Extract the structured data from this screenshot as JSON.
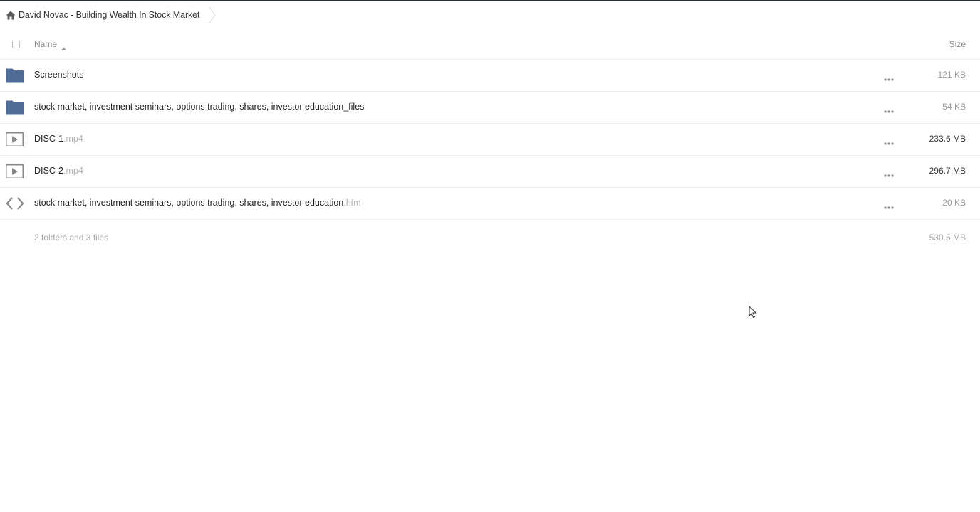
{
  "breadcrumb": {
    "home_icon": "home-icon",
    "label": "David Novac - Building Wealth In Stock Market"
  },
  "columns": {
    "name": "Name",
    "size": "Size",
    "sort": "ascending"
  },
  "rows": [
    {
      "icon": "folder-icon",
      "name": "Screenshots",
      "ext": "",
      "size": "121 KB",
      "size_emphasis": false
    },
    {
      "icon": "folder-icon",
      "name": "stock market, investment seminars, options trading, shares, investor education_files",
      "ext": "",
      "size": "54 KB",
      "size_emphasis": false
    },
    {
      "icon": "video-file-icon",
      "name": "DISC-1",
      "ext": ".mp4",
      "size": "233.6 MB",
      "size_emphasis": true
    },
    {
      "icon": "video-file-icon",
      "name": "DISC-2",
      "ext": ".mp4",
      "size": "296.7 MB",
      "size_emphasis": true
    },
    {
      "icon": "code-file-icon",
      "name": "stock market, investment seminars, options trading, shares, investor education",
      "ext": ".htm",
      "size": "20 KB",
      "size_emphasis": false
    }
  ],
  "footer": {
    "count": "2 folders and 3 files",
    "total_size": "530.5 MB"
  },
  "colors": {
    "folder": "#4f6c96",
    "icon_gray": "#8a8a8a",
    "row_divider": "#ededed",
    "muted_text": "#9a9a9a"
  }
}
